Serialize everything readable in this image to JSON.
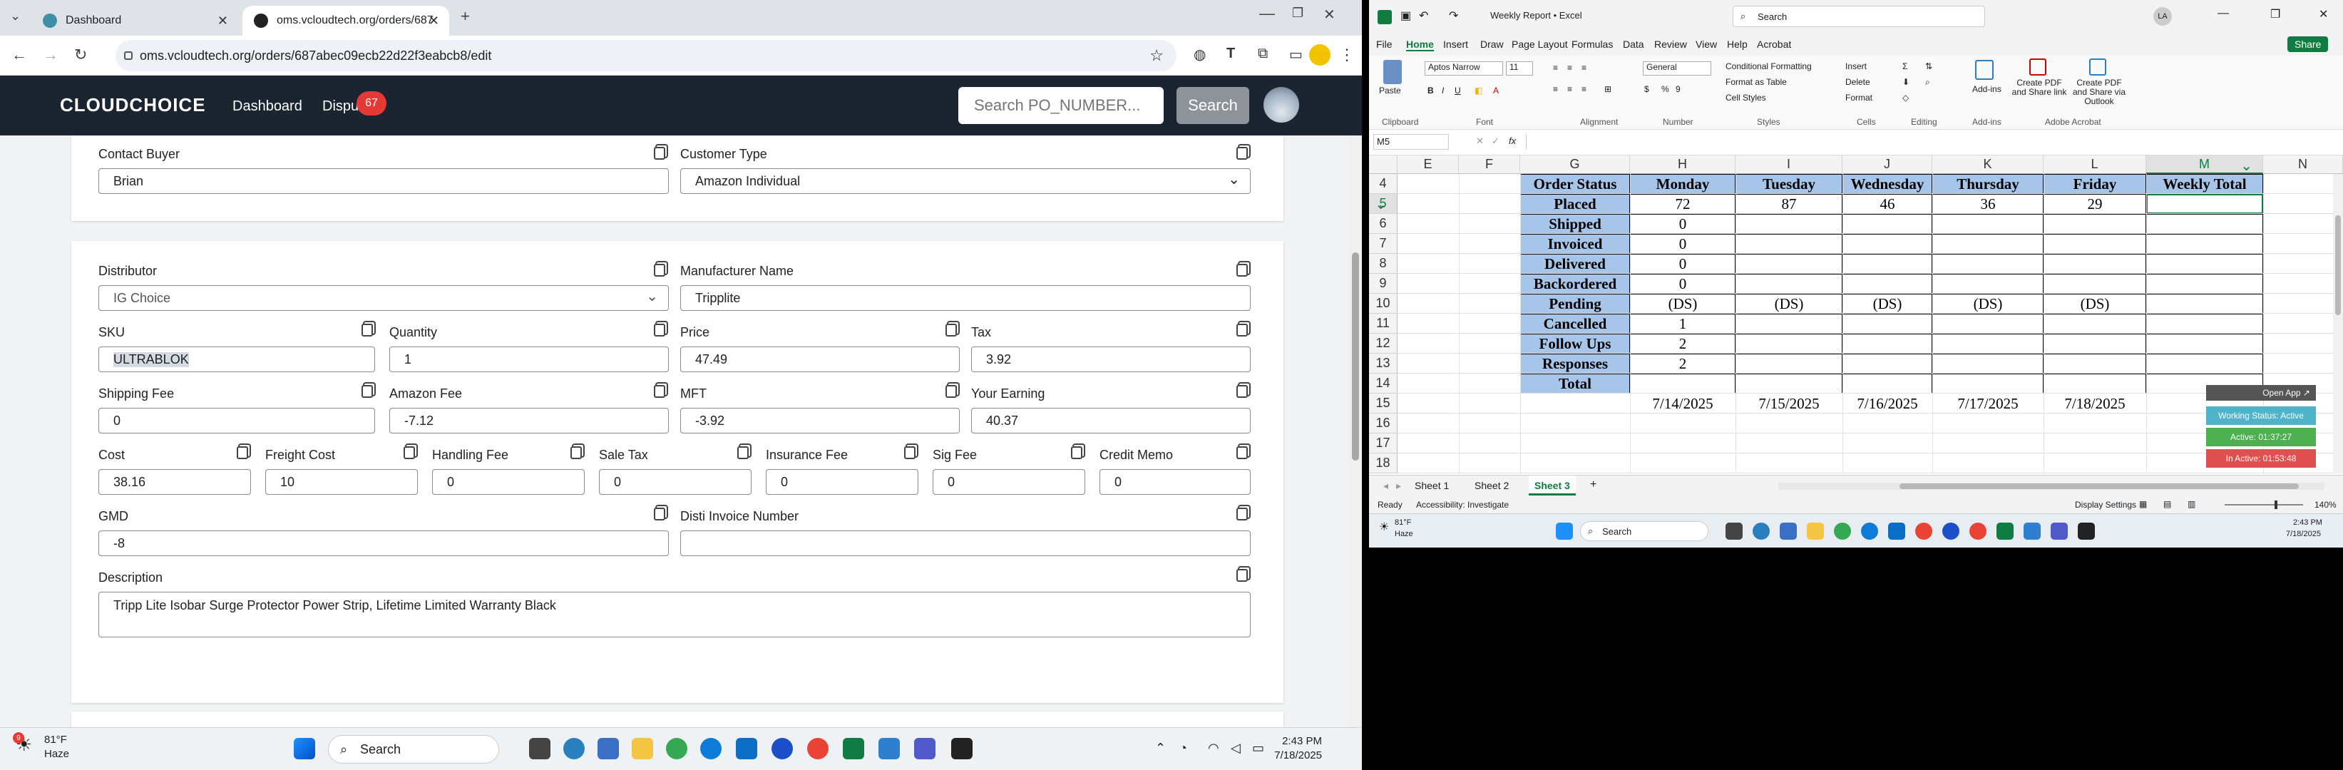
{
  "browser": {
    "tabs": [
      {
        "label": "Dashboard",
        "active": false
      },
      {
        "label": "oms.vcloudtech.org/orders/687",
        "active": true
      }
    ],
    "new_tab": "+",
    "url": "oms.vcloudtech.org/orders/687abec09ecb22d22f3eabcb8/edit"
  },
  "app": {
    "logo": "CLOUDCHOICE",
    "nav": {
      "dashboard": "Dashboard",
      "disputes": "Dispu"
    },
    "disputes_badge": "67",
    "search_placeholder": "Search PO_NUMBER...",
    "search_button": "Search"
  },
  "form": {
    "contact_buyer": {
      "label": "Contact Buyer",
      "value": "Brian"
    },
    "customer_type": {
      "label": "Customer Type",
      "value": "Amazon Individual"
    },
    "distributor": {
      "label": "Distributor",
      "value": "IG Choice"
    },
    "manufacturer_name": {
      "label": "Manufacturer Name",
      "value": "Tripplite"
    },
    "sku": {
      "label": "SKU",
      "value": "ULTRABLOK"
    },
    "quantity": {
      "label": "Quantity",
      "value": "1"
    },
    "price": {
      "label": "Price",
      "value": "47.49"
    },
    "tax": {
      "label": "Tax",
      "value": "3.92"
    },
    "shipping_fee": {
      "label": "Shipping Fee",
      "value": "0"
    },
    "amazon_fee": {
      "label": "Amazon Fee",
      "value": "-7.12"
    },
    "mft": {
      "label": "MFT",
      "value": "-3.92"
    },
    "your_earning": {
      "label": "Your Earning",
      "value": "40.37"
    },
    "cost": {
      "label": "Cost",
      "value": "38.16"
    },
    "freight_cost": {
      "label": "Freight Cost",
      "value": "10"
    },
    "handling_fee": {
      "label": "Handling Fee",
      "value": "0"
    },
    "sale_tax": {
      "label": "Sale Tax",
      "value": "0"
    },
    "insurance_fee": {
      "label": "Insurance Fee",
      "value": "0"
    },
    "sig_fee": {
      "label": "Sig Fee",
      "value": "0"
    },
    "credit_memo": {
      "label": "Credit Memo",
      "value": "0"
    },
    "gmd": {
      "label": "GMD",
      "value": "-8"
    },
    "disti_invoice_number": {
      "label": "Disti Invoice Number",
      "value": ""
    },
    "description": {
      "label": "Description",
      "value": "Tripp Lite Isobar Surge Protector Power Strip, Lifetime Limited Warranty Black"
    }
  },
  "taskbar_left": {
    "weather_temp": "81°F",
    "weather_desc": "Haze",
    "weather_badge": "9",
    "search": "Search",
    "time": "2:43 PM",
    "date": "7/18/2025"
  },
  "excel": {
    "title": "Weekly Report  •  Excel",
    "search": "Search",
    "user_initials": "LA",
    "menu": [
      "File",
      "Home",
      "Insert",
      "Draw",
      "Page Layout",
      "Formulas",
      "Data",
      "Review",
      "View",
      "Help",
      "Acrobat"
    ],
    "share": "Share",
    "ribbon": {
      "paste": "Paste",
      "clipboard": "Clipboard",
      "font_name": "Aptos Narrow",
      "font_size": "11",
      "font": "Font",
      "alignment": "Alignment",
      "number_format": "General",
      "number": "Number",
      "conditional_formatting": "Conditional Formatting",
      "format_as_table": "Format as Table",
      "cell_styles": "Cell Styles",
      "styles": "Styles",
      "insert": "Insert",
      "delete": "Delete",
      "format": "Format",
      "cells": "Cells",
      "editing": "Editing",
      "addins": "Add-ins",
      "addins_group": "Add-ins",
      "create_pdf_share": "Create PDF and Share link",
      "create_pdf_outlook": "Create PDF and Share via Outlook",
      "adobe_acrobat": "Adobe Acrobat"
    },
    "name_box": "M5",
    "fx": "fx",
    "columns": [
      "E",
      "F",
      "G",
      "H",
      "I",
      "J",
      "K",
      "L",
      "M",
      "N"
    ],
    "rows": [
      "4",
      "5",
      "6",
      "7",
      "8",
      "9",
      "10",
      "11",
      "12",
      "13",
      "14",
      "15",
      "16",
      "17",
      "18"
    ],
    "table": {
      "header": [
        "Order Status",
        "Monday",
        "Tuesday",
        "Wednesday",
        "Thursday",
        "Friday",
        "Weekly Total"
      ],
      "body": [
        [
          "Placed",
          "72",
          "87",
          "46",
          "36",
          "29",
          ""
        ],
        [
          "Shipped",
          "0",
          "",
          "",
          "",
          "",
          ""
        ],
        [
          "Invoiced",
          "0",
          "",
          "",
          "",
          "",
          ""
        ],
        [
          "Delivered",
          "0",
          "",
          "",
          "",
          "",
          ""
        ],
        [
          "Backordered",
          "0",
          "",
          "",
          "",
          "",
          ""
        ],
        [
          "Pending",
          "(DS)",
          "(DS)",
          "(DS)",
          "(DS)",
          "(DS)",
          ""
        ],
        [
          "Cancelled",
          "1",
          "",
          "",
          "",
          "",
          ""
        ],
        [
          "Follow Ups",
          "2",
          "",
          "",
          "",
          "",
          ""
        ],
        [
          "Responses",
          "2",
          "",
          "",
          "",
          "",
          ""
        ],
        [
          "Total",
          "",
          "",
          "",
          "",
          "",
          ""
        ]
      ],
      "dates": [
        "7/14/2025",
        "7/15/2025",
        "7/16/2025",
        "7/17/2025",
        "7/18/2025"
      ]
    },
    "widget": {
      "open_app": "Open App ↗",
      "status": "Working Status: Active",
      "active": "Active: 01:37:27",
      "inactive": "In Active: 01:53:48"
    },
    "sheets": [
      "Sheet 1",
      "Sheet 2",
      "Sheet 3"
    ],
    "active_sheet": "Sheet 3",
    "status": {
      "ready": "Ready",
      "accessibility": "Accessibility: Investigate",
      "display_settings": "Display Settings",
      "zoom": "140%"
    },
    "taskbar": {
      "temp": "81°F",
      "desc": "Haze",
      "search": "Search",
      "time": "2:43 PM",
      "date": "7/18/2025"
    }
  }
}
